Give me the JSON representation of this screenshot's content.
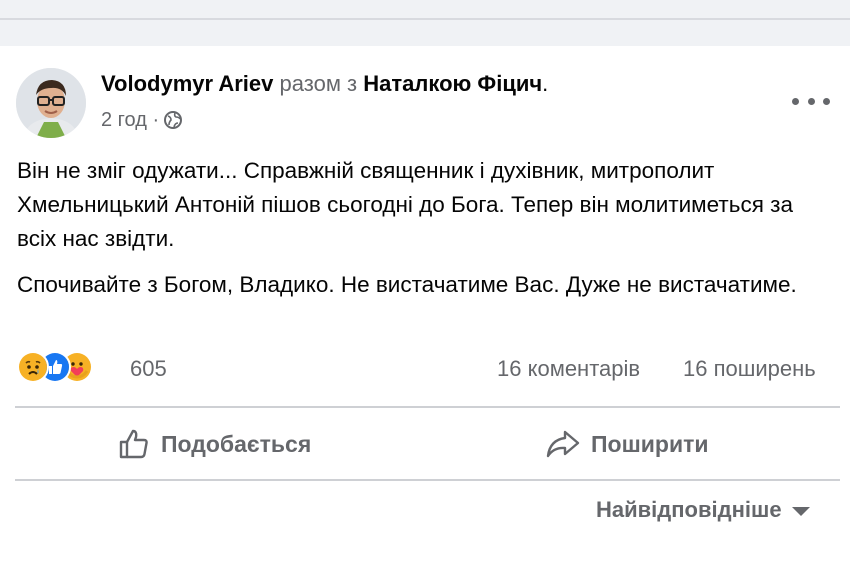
{
  "post": {
    "author": "Volodymyr Ariev",
    "with_text": "разом з",
    "tagged": "Наталкою Фіцич",
    "period": ".",
    "time": "2 год ·",
    "privacy_icon": "globe-icon",
    "more_icon": "more-options-icon",
    "paragraphs": [
      "Він не зміг одужати... Справжній священник і духівник, митрополит Хмельницький Антоній пішов сьогодні до Бога. Тепер він молитиметься за всіх нас звідти.",
      "Спочивайте з Богом, Владико. Не вистачатиме Вас. Дуже не вистачатиме."
    ],
    "reactions": {
      "icons": [
        "sad-reaction-icon",
        "like-reaction-icon",
        "care-reaction-icon"
      ],
      "count": "605"
    },
    "comments": "16 коментарів",
    "shares": "16 поширень"
  },
  "actions": {
    "like_label": "Подобається",
    "share_label": "Поширити"
  },
  "comments_sort": {
    "label": "Найвідповідніше",
    "icon": "caret-down-icon"
  },
  "colors": {
    "text_primary": "#050505",
    "text_secondary": "#65676b",
    "divider": "#ced0d4",
    "feed_background": "#f0f2f5",
    "like_blue": "#1877f2",
    "sad_yellow": "#f7b125"
  }
}
